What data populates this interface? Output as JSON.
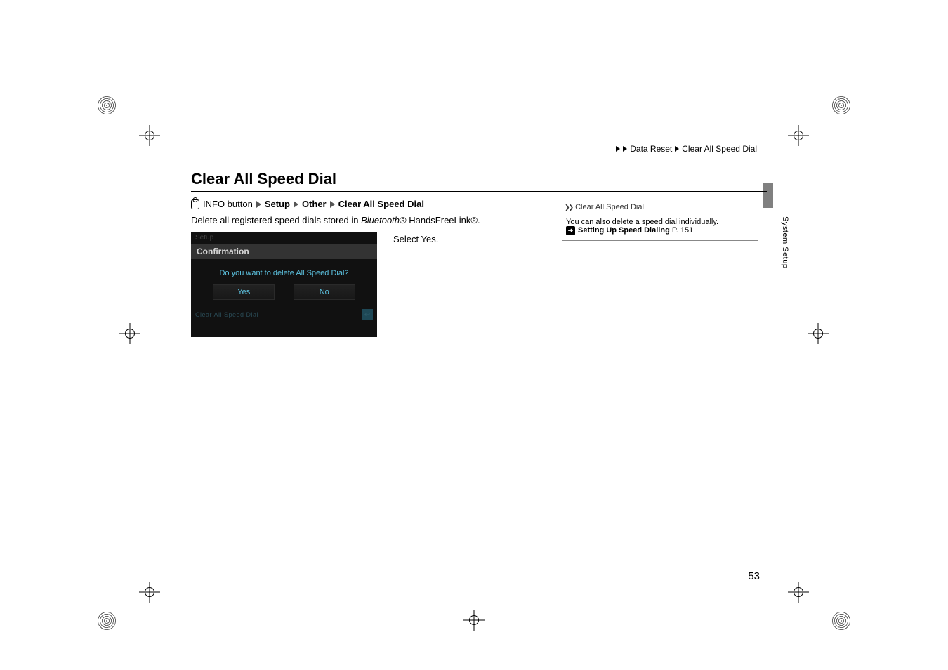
{
  "runhead": {
    "seg1": "Data Reset",
    "seg2": "Clear All Speed Dial"
  },
  "heading": "Clear All Speed Dial",
  "breadcrumb": {
    "info": "INFO button",
    "setup": "Setup",
    "other": "Other",
    "clear": "Clear All Speed Dial"
  },
  "description": {
    "prefix": "Delete all registered speed dials stored in ",
    "bt": "Bluetooth",
    "suffix": "® HandsFreeLink®."
  },
  "select_line": {
    "prefix": "Select ",
    "yes": "Yes",
    "suffix": "."
  },
  "lcd": {
    "setup": "Setup",
    "confirmation": "Confirmation",
    "question": "Do you want to delete All Speed Dial?",
    "yes": "Yes",
    "no": "No",
    "footer": "Clear All Speed Dial"
  },
  "callout": {
    "title": "Clear All Speed Dial",
    "line1": "You can also delete a speed dial individually.",
    "link_label": "Setting Up Speed Dialing",
    "page_ref": "P. 151"
  },
  "side_label": "System Setup",
  "page_number": "53"
}
